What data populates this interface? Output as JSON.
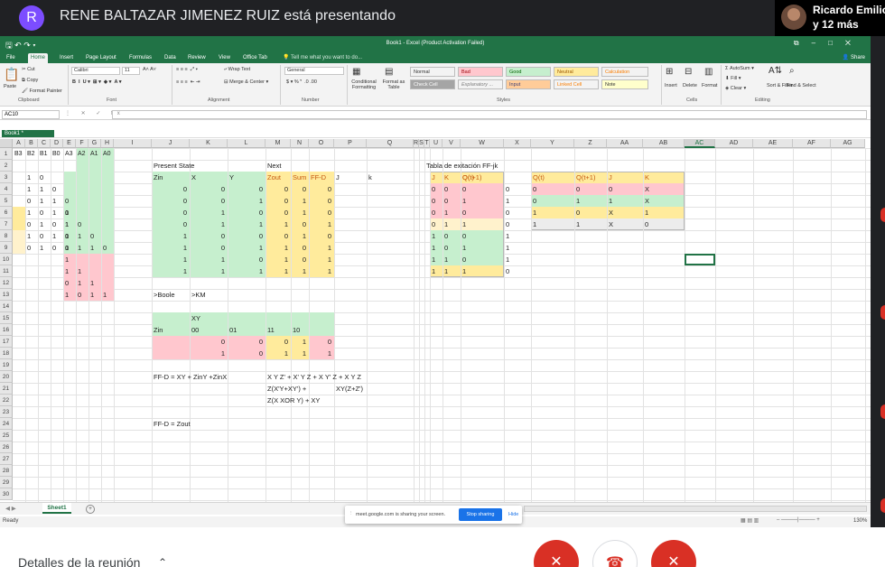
{
  "meet": {
    "avatar_letter": "R",
    "presenting_title": "RENE BALTAZAR JIMENEZ RUIZ está presentando",
    "participant_name": "Ricardo Emilio",
    "participant_more": "y 12 más",
    "meeting_details": "Detalles de la reunión",
    "sharing_text": "meet.google.com is sharing your screen.",
    "stop_sharing": "Stop sharing",
    "hide": "Hide",
    "mic_icon": "mic-off-icon",
    "end_icon": "phone-hangup-icon",
    "cam_icon": "camera-off-icon"
  },
  "excel": {
    "title": "Book1 - Excel (Product Activation Failed)",
    "tabs": [
      "File",
      "Home",
      "Insert",
      "Page Layout",
      "Formulas",
      "Data",
      "Review",
      "View",
      "Office Tab"
    ],
    "tell_me": "Tell me what you want to do...",
    "share": "Share",
    "book_tab": "Book1 *",
    "name_box": "AC10",
    "sheet_tab": "Sheet1",
    "status": "Ready",
    "zoom": "130%",
    "ribbon": {
      "cut": "Cut",
      "copy": "Copy",
      "format_painter": "Format Painter",
      "paste": "Paste",
      "font_name": "Calibri",
      "font_size": "11",
      "wrap_text": "Wrap Text",
      "merge_center": "Merge & Center",
      "number_format": "General",
      "conditional": "Conditional Formatting",
      "format_table": "Format as Table",
      "insert": "Insert",
      "delete": "Delete",
      "format": "Format",
      "autosum": "AutoSum",
      "fill": "Fill",
      "clear": "Clear",
      "sort_filter": "Sort & Filter",
      "find_select": "Find & Select",
      "styles": [
        {
          "label": "Normal",
          "bg": "#ffffff",
          "fg": "#000000"
        },
        {
          "label": "Bad",
          "bg": "#ffc7ce",
          "fg": "#9c0006"
        },
        {
          "label": "Good",
          "bg": "#c6efce",
          "fg": "#006100"
        },
        {
          "label": "Neutral",
          "bg": "#ffeb9c",
          "fg": "#9c5700"
        },
        {
          "label": "Calculation",
          "bg": "#f2f2f2",
          "fg": "#fa7d00"
        },
        {
          "label": "Check Cell",
          "bg": "#a5a5a5",
          "fg": "#ffffff"
        },
        {
          "label": "Explanatory ...",
          "bg": "#ffffff",
          "fg": "#7f7f7f"
        },
        {
          "label": "Input",
          "bg": "#ffcc99",
          "fg": "#3f3f76"
        },
        {
          "label": "Linked Cell",
          "bg": "#ffffff",
          "fg": "#fa7d00"
        },
        {
          "label": "Note",
          "bg": "#ffffcc",
          "fg": "#000000"
        }
      ],
      "groups": [
        "Clipboard",
        "Font",
        "Alignment",
        "Number",
        "Styles",
        "Cells",
        "Editing"
      ]
    },
    "columns": [
      "A",
      "B",
      "C",
      "D",
      "E",
      "F",
      "G",
      "H",
      "I",
      "J",
      "K",
      "L",
      "M",
      "N",
      "O",
      "P",
      "Q",
      "R",
      "S",
      "T",
      "U",
      "V",
      "W",
      "X",
      "Y",
      "Z",
      "AA",
      "AB",
      "AC",
      "AD",
      "AE",
      "AF",
      "AG"
    ],
    "rows": [
      "1",
      "2",
      "3",
      "4",
      "5",
      "6",
      "7",
      "8",
      "9",
      "10",
      "11",
      "12",
      "13",
      "14",
      "15",
      "16",
      "17",
      "18",
      "19",
      "20",
      "21",
      "22",
      "23",
      "24",
      "25",
      "26",
      "27",
      "28",
      "29",
      "30"
    ],
    "headers_row1": [
      "B3",
      "B2",
      "B1",
      "B0",
      "A3",
      "A2",
      "A1",
      "A0"
    ],
    "b_rows": [
      [
        "1",
        "0",
        "",
        ""
      ],
      [
        "1",
        "1",
        "0",
        ""
      ],
      [
        "0",
        "1",
        "1",
        "0"
      ],
      [
        "1",
        "0",
        "1",
        "1"
      ],
      [
        "0",
        "1",
        "0",
        "1"
      ],
      [
        "1",
        "0",
        "1",
        "0"
      ],
      [
        "0",
        "1",
        "0",
        "1"
      ]
    ],
    "a_rows": [
      [
        "",
        "",
        "",
        ""
      ],
      [
        "",
        "",
        "",
        ""
      ],
      [
        "",
        "",
        "",
        ""
      ],
      [
        "0",
        "",
        "",
        ""
      ],
      [
        "1",
        "0",
        "",
        ""
      ],
      [
        "1",
        "1",
        "0",
        ""
      ],
      [
        "0",
        "1",
        "1",
        "0"
      ],
      [
        "1",
        "",
        "",
        ""
      ],
      [
        "1",
        "1",
        "",
        ""
      ],
      [
        "0",
        "1",
        "1",
        ""
      ],
      [
        "1",
        "0",
        "1",
        "1"
      ]
    ],
    "present_state": "Present State",
    "next": "Next",
    "state_headers": [
      "Zin",
      "X",
      "Y",
      "Zout",
      "Sum",
      "FF-D",
      "J",
      "k"
    ],
    "state_rows": [
      [
        "0",
        "0",
        "0",
        "0",
        "0",
        "0"
      ],
      [
        "0",
        "0",
        "1",
        "0",
        "1",
        "0"
      ],
      [
        "0",
        "1",
        "0",
        "0",
        "1",
        "0"
      ],
      [
        "0",
        "1",
        "1",
        "1",
        "0",
        "1"
      ],
      [
        "1",
        "0",
        "0",
        "0",
        "1",
        "0"
      ],
      [
        "1",
        "0",
        "1",
        "1",
        "0",
        "1"
      ],
      [
        "1",
        "1",
        "0",
        "1",
        "0",
        "1"
      ],
      [
        "1",
        "1",
        "1",
        "1",
        "1",
        "1"
      ]
    ],
    "boole": ">Boole",
    "km": ">KM",
    "km_xy": "XY",
    "km_cols": [
      "00",
      "01",
      "11",
      "10"
    ],
    "km_zin": "Zin",
    "km_rows": [
      [
        "0",
        "0",
        "0",
        "1",
        "0"
      ],
      [
        "1",
        "0",
        "1",
        "1",
        "1"
      ]
    ],
    "formula_ffd": "FF-D = XY + ZinY +ZinX",
    "eq1": "X Y Z' + X' Y Z + X Y' Z + X Y Z",
    "eq2": "Z(X'Y+XY') +",
    "eq3": "XY(Z+Z')",
    "eq4": "Z(X XOR Y) + XY",
    "formula_ffd2": "FF-D = Zout",
    "jk_title": "Tabla de exitación FF-jk",
    "jk_headers": [
      "J",
      "K",
      "Q(t)",
      "Q(t+1)"
    ],
    "jk_rows": [
      [
        "0",
        "0",
        "0",
        "0"
      ],
      [
        "0",
        "0",
        "1",
        "1"
      ],
      [
        "0",
        "1",
        "0",
        "0"
      ],
      [
        "0",
        "1",
        "1",
        "0"
      ],
      [
        "1",
        "0",
        "0",
        "1"
      ],
      [
        "1",
        "0",
        "1",
        "1"
      ],
      [
        "1",
        "1",
        "0",
        "1"
      ],
      [
        "1",
        "1",
        "1",
        "0"
      ]
    ],
    "jk2_headers": [
      "Q(t)",
      "Q(t+1)",
      "J",
      "K"
    ],
    "jk2_rows": [
      [
        "0",
        "0",
        "0",
        "X"
      ],
      [
        "0",
        "1",
        "1",
        "X"
      ],
      [
        "1",
        "0",
        "X",
        "1"
      ],
      [
        "1",
        "1",
        "X",
        "0"
      ]
    ]
  }
}
